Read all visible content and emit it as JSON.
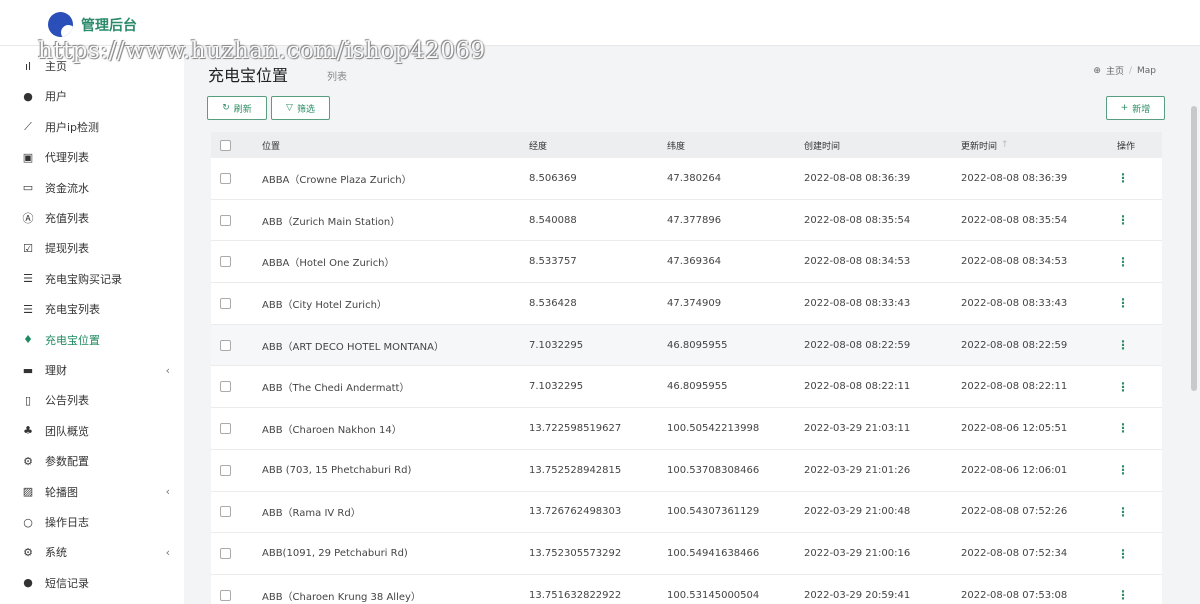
{
  "app": {
    "title": "管理后台"
  },
  "watermark": "https://www.huzhan.com/ishop42069",
  "sidebar": {
    "items": [
      {
        "label": "主页",
        "icon": "bar-chart-icon",
        "glyph": "ıl",
        "caret": ""
      },
      {
        "label": "用户",
        "icon": "user-icon",
        "glyph": "●",
        "caret": ""
      },
      {
        "label": "用户ip检测",
        "icon": "line-chart-icon",
        "glyph": "⟋",
        "caret": ""
      },
      {
        "label": "代理列表",
        "icon": "contact-book-icon",
        "glyph": "▣",
        "caret": ""
      },
      {
        "label": "资金流水",
        "icon": "money-icon",
        "glyph": "▭",
        "caret": ""
      },
      {
        "label": "充值列表",
        "icon": "app-store-icon",
        "glyph": "Ⓐ",
        "caret": ""
      },
      {
        "label": "提现列表",
        "icon": "check-square-icon",
        "glyph": "☑",
        "caret": ""
      },
      {
        "label": "充电宝购买记录",
        "icon": "list-icon",
        "glyph": "☰",
        "caret": ""
      },
      {
        "label": "充电宝列表",
        "icon": "indent-list-icon",
        "glyph": "☰",
        "caret": ""
      },
      {
        "label": "充电宝位置",
        "icon": "map-pin-icon",
        "glyph": "♦",
        "caret": ""
      },
      {
        "label": "理财",
        "icon": "archive-icon",
        "glyph": "▬",
        "caret": "‹"
      },
      {
        "label": "公告列表",
        "icon": "document-icon",
        "glyph": "▯",
        "caret": ""
      },
      {
        "label": "团队概览",
        "icon": "users-icon",
        "glyph": "♣",
        "caret": ""
      },
      {
        "label": "参数配置",
        "icon": "cogs-icon",
        "glyph": "⚙",
        "caret": ""
      },
      {
        "label": "轮播图",
        "icon": "image-icon",
        "glyph": "▨",
        "caret": "‹"
      },
      {
        "label": "操作日志",
        "icon": "circle-icon",
        "glyph": "○",
        "caret": ""
      },
      {
        "label": "系统",
        "icon": "gear-icon",
        "glyph": "⚙",
        "caret": "‹"
      },
      {
        "label": "短信记录",
        "icon": "comment-icon",
        "glyph": "●",
        "caret": ""
      }
    ],
    "active_index": 9
  },
  "page": {
    "title": "充电宝位置",
    "subtitle": "列表",
    "breadcrumb": {
      "home": "主页",
      "current": "Map",
      "separator": "/"
    }
  },
  "toolbar": {
    "refresh_label": "刷新",
    "filter_label": "筛选",
    "add_label": "新增",
    "refresh_glyph": "↻",
    "filter_glyph": "▽",
    "add_glyph": "+"
  },
  "table": {
    "headers": {
      "location": "位置",
      "longitude": "经度",
      "latitude": "纬度",
      "created": "创建时间",
      "updated": "更新时间",
      "sort": "↑",
      "actions": "操作"
    },
    "rows": [
      {
        "location": "ABBA（Crowne Plaza Zurich）",
        "longitude": "8.506369",
        "latitude": "47.380264",
        "created": "2022-08-08 08:36:39",
        "updated": "2022-08-08 08:36:39",
        "highlight": false
      },
      {
        "location": "ABB（Zurich Main Station）",
        "longitude": "8.540088",
        "latitude": "47.377896",
        "created": "2022-08-08 08:35:54",
        "updated": "2022-08-08 08:35:54",
        "highlight": false
      },
      {
        "location": "ABBA（Hotel One Zurich）",
        "longitude": "8.533757",
        "latitude": "47.369364",
        "created": "2022-08-08 08:34:53",
        "updated": "2022-08-08 08:34:53",
        "highlight": false
      },
      {
        "location": "ABB（City Hotel Zurich）",
        "longitude": "8.536428",
        "latitude": "47.374909",
        "created": "2022-08-08 08:33:43",
        "updated": "2022-08-08 08:33:43",
        "highlight": false
      },
      {
        "location": "ABB（ART DECO HOTEL MONTANA）",
        "longitude": "7.1032295",
        "latitude": "46.8095955",
        "created": "2022-08-08 08:22:59",
        "updated": "2022-08-08 08:22:59",
        "highlight": true
      },
      {
        "location": "ABB（The Chedi Andermatt）",
        "longitude": "7.1032295",
        "latitude": "46.8095955",
        "created": "2022-08-08 08:22:11",
        "updated": "2022-08-08 08:22:11",
        "highlight": false
      },
      {
        "location": "ABB（Charoen Nakhon 14）",
        "longitude": "13.722598519627",
        "latitude": "100.50542213998",
        "created": "2022-03-29 21:03:11",
        "updated": "2022-08-06 12:05:51",
        "highlight": false
      },
      {
        "location": "ABB (703, 15 Phetchaburi Rd)",
        "longitude": "13.752528942815",
        "latitude": "100.53708308466",
        "created": "2022-03-29 21:01:26",
        "updated": "2022-08-06 12:06:01",
        "highlight": false
      },
      {
        "location": "ABB（Rama IV Rd）",
        "longitude": "13.726762498303",
        "latitude": "100.54307361129",
        "created": "2022-03-29 21:00:48",
        "updated": "2022-08-08 07:52:26",
        "highlight": false
      },
      {
        "location": "ABB(1091, 29 Petchaburi Rd)",
        "longitude": "13.752305573292",
        "latitude": "100.54941638466",
        "created": "2022-03-29 21:00:16",
        "updated": "2022-08-08 07:52:34",
        "highlight": false
      },
      {
        "location": "ABB（Charoen Krung 38 Alley）",
        "longitude": "13.751632822922",
        "latitude": "100.53145000504",
        "created": "2022-03-29 20:59:41",
        "updated": "2022-08-08 07:53:08",
        "highlight": false
      }
    ],
    "action_glyph": "⋮"
  },
  "colors": {
    "accent": "#2e8c66",
    "brand": "#2b4fb8",
    "sidebar_bg": "#ffffff",
    "page_bg": "#f3f4f6"
  }
}
